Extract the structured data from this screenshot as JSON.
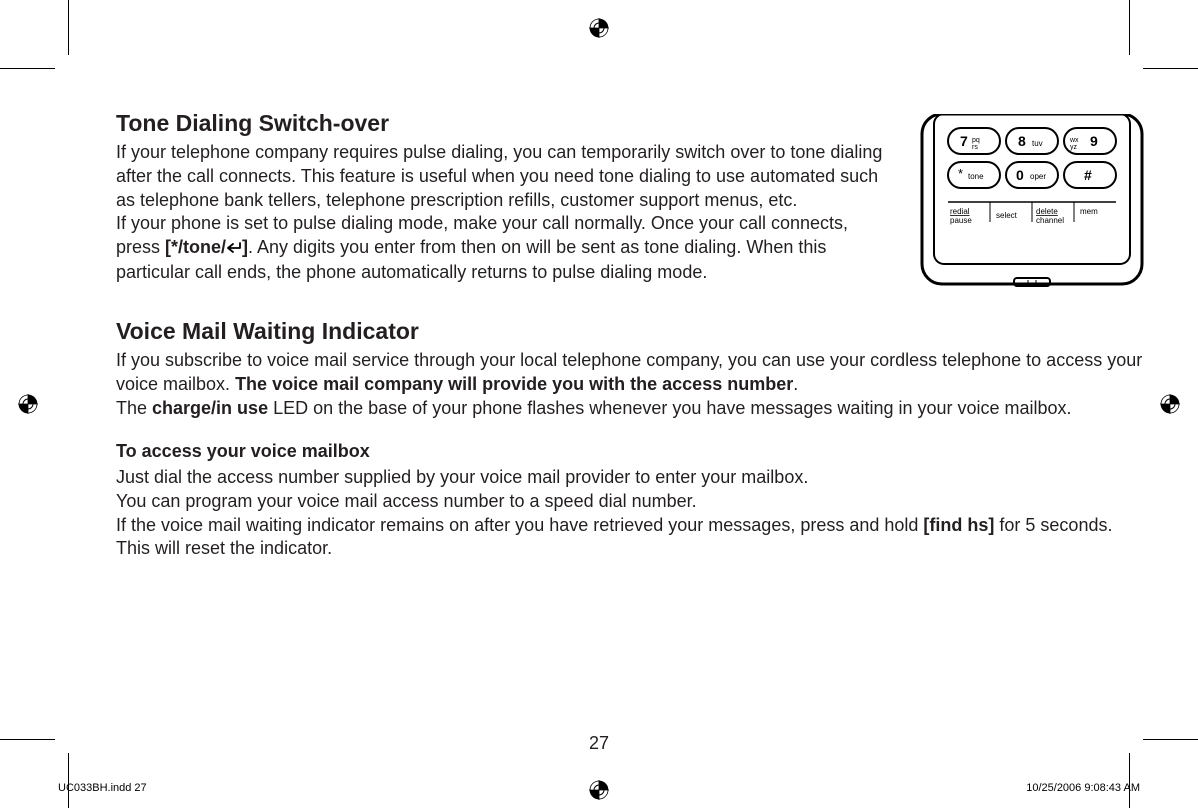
{
  "page_number": "27",
  "footer": {
    "filename": "UC033BH.indd   27",
    "timestamp": "10/25/2006   9:08:43 AM"
  },
  "section1": {
    "heading": "Tone Dialing Switch-over",
    "p1": "If your telephone company requires pulse dialing, you can temporarily switch over to tone dialing after the call connects. This feature is useful when you need tone dialing to use automated such as telephone bank tellers, telephone prescription refills, customer support menus, etc.",
    "p2a": "If your phone is set to pulse dialing mode, make your call normally. Once your call connects, press ",
    "p2_key": "[*/tone/",
    "p2_key_close": "]",
    "p2b": ". Any digits you enter from then on will be sent as tone dialing. When this particular call ends, the phone automatically returns to pulse dialing mode."
  },
  "section2": {
    "heading": "Voice Mail Waiting Indicator",
    "p1a": "If you subscribe to voice mail service through your local telephone company, you can use your cordless telephone to access your voice mailbox. ",
    "p1b": "The voice mail company will provide you with the access number",
    "p1c": ".",
    "p2a": "The ",
    "p2b": "charge/in use",
    "p2c": " LED on the base of your phone flashes whenever you have messages waiting in your voice mailbox.",
    "sub": "To access your voice mailbox",
    "p3": "Just dial the access number supplied by your voice mail provider to enter your mailbox.",
    "p4": "You can program your voice mail access number to a speed dial number.",
    "p5a": "If the voice mail waiting indicator remains on after you have retrieved your messages, press and hold ",
    "p5b": "[find hs]",
    "p5c": " for 5 seconds. This will reset the indicator."
  },
  "phone_illustration": {
    "row1": [
      "7 pqrs",
      "8 tuv",
      "9 wxyz"
    ],
    "row2": [
      "* tone",
      "0 oper",
      "#"
    ],
    "labels": [
      "redial pause",
      "select",
      "delete channel",
      "mem"
    ]
  }
}
